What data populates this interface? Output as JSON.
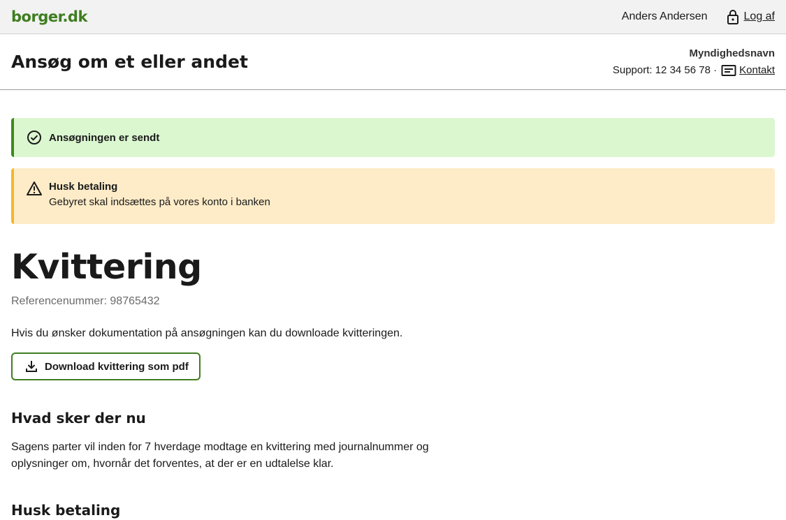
{
  "topbar": {
    "logo": "borger.dk",
    "user_name": "Anders Andersen",
    "logout_label": "Log af"
  },
  "header": {
    "title": "Ansøg om et eller andet",
    "authority": "Myndighedsnavn",
    "support": "Support: 12 34 56 78 ·",
    "contact_label": "Kontakt"
  },
  "alerts": {
    "success": {
      "title": "Ansøgningen er sendt"
    },
    "warning": {
      "title": "Husk betaling",
      "text": "Gebyret skal indsættes på vores konto i banken"
    }
  },
  "receipt": {
    "title": "Kvittering",
    "reference": "Referencenummer: 98765432",
    "doc_text": "Hvis du ønsker dokumentation på ansøgningen kan du downloade kvitteringen.",
    "download_label": "Download kvittering som pdf"
  },
  "next": {
    "heading": "Hvad sker der nu",
    "text": "Sagens parter vil inden for 7 hverdage modtage en kvittering med journalnummer og oplysninger om, hvornår det forventes, at der er en udtalelse klar."
  },
  "payment": {
    "heading": "Husk betaling"
  },
  "colors": {
    "brand": "#3f7d20",
    "success_bg": "#dbf7d0",
    "warning_bg": "#feecc8",
    "warning_border": "#f4b72c"
  },
  "icons": {
    "logout": "lock-icon",
    "contact": "contact-card-icon",
    "success": "check-circle-icon",
    "warning": "warning-triangle-icon",
    "download": "download-icon"
  }
}
